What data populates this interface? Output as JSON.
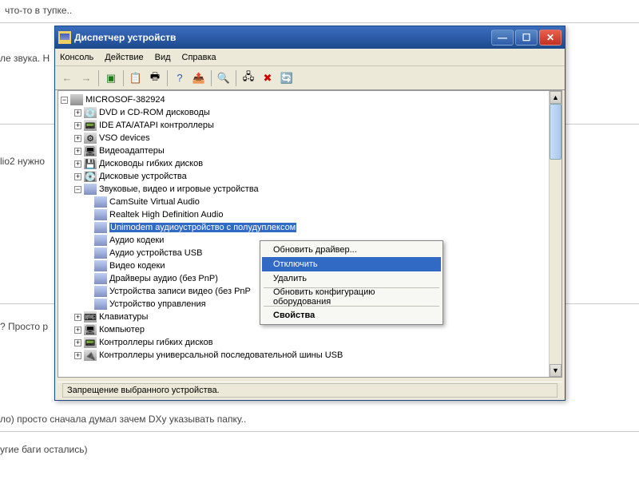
{
  "bg": {
    "line1": "что-то в тупке..",
    "line2": "ле звука. Н",
    "line3": "lio2 нужно",
    "line4": "? Просто р",
    "line5": "ло) просто сначала думал зачем DXy указывать папку..",
    "line6": "угие баги остались)"
  },
  "window": {
    "title": "Диспетчер устройств"
  },
  "menus": [
    "Консоль",
    "Действие",
    "Вид",
    "Справка"
  ],
  "root": "MICROSOF-382924",
  "cats": [
    {
      "expand": "+",
      "icon": "💿",
      "label": "DVD и CD-ROM дисководы"
    },
    {
      "expand": "+",
      "icon": "📟",
      "label": "IDE ATA/ATAPI контроллеры"
    },
    {
      "expand": "+",
      "icon": "⚙",
      "label": "VSO devices"
    },
    {
      "expand": "+",
      "icon": "🖥",
      "label": "Видеоадаптеры"
    },
    {
      "expand": "+",
      "icon": "💾",
      "label": "Дисководы гибких дисков"
    },
    {
      "expand": "+",
      "icon": "💽",
      "label": "Дисковые устройства"
    }
  ],
  "audiocat": {
    "expand": "−",
    "icon": "🔊",
    "label": "Звуковые, видео и игровые устройства"
  },
  "audiochildren": [
    {
      "label": "CamSuite Virtual Audio"
    },
    {
      "label": "Realtek High Definition Audio"
    },
    {
      "label": "Unimodem аудиоустройство с полудуплексом",
      "selected": true
    },
    {
      "label": "Аудио кодеки"
    },
    {
      "label": "Аудио устройства USB"
    },
    {
      "label": "Видео кодеки"
    },
    {
      "label": "Драйверы аудио (без PnP)"
    },
    {
      "label": "Устройства записи видео (без PnP"
    },
    {
      "label": "Устройство управления"
    }
  ],
  "cats2": [
    {
      "expand": "+",
      "icon": "⌨",
      "label": "Клавиатуры"
    },
    {
      "expand": "+",
      "icon": "🖥",
      "label": "Компьютер"
    },
    {
      "expand": "+",
      "icon": "📟",
      "label": "Контроллеры гибких дисков"
    },
    {
      "expand": "+",
      "icon": "🔌",
      "label": "Контроллеры универсальной последовательной шины USB"
    }
  ],
  "ctx": {
    "update": "Обновить драйвер...",
    "disable": "Отключить",
    "delete": "Удалить",
    "refresh": "Обновить конфигурацию оборудования",
    "props": "Свойства"
  },
  "status": "Запрещение выбранного устройства."
}
